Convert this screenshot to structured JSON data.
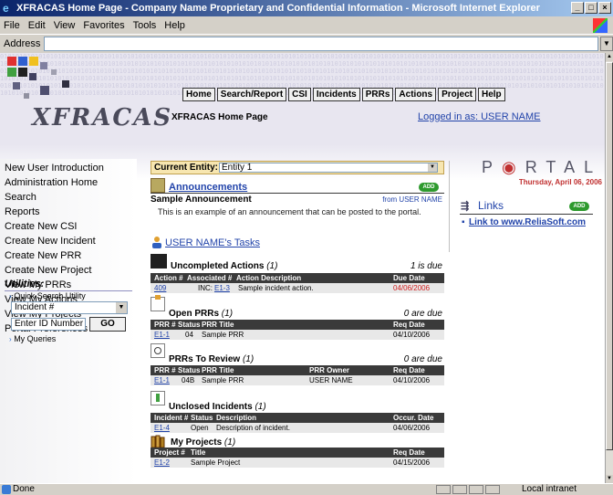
{
  "window": {
    "title": "XFRACAS Home Page - Company Name Proprietary and Confidential Information - Microsoft Internet Explorer"
  },
  "menu": [
    "File",
    "Edit",
    "View",
    "Favorites",
    "Tools",
    "Help"
  ],
  "address": {
    "label": "Address",
    "value": ""
  },
  "header": {
    "logo": "XFRACAS",
    "page_title": "XFRACAS Home Page",
    "logged_in": "Logged in as: USER NAME",
    "binary_bg": "010101010101010101010101010101010101010101010101010101010101010101010101010101010101010101010101010101010101010101010101010101010101010101010101010101010101010101010101010101010101010101010101010101010101010101010101010101010101010101010101010101010101010101010101010101010101010101010101010101010101010101010101010101010101010101010101010101010101010101010101010101010101010101010101010101010101010101010101010101010101010101010101010101010101010101010101010101010101010101010101010101010101010101010101010101010101010101010101010101010101010101010101010101010101010101010101010101010101010101010101010101010101010101010101010101010101010101010101010101010101010101010101010101010101010101010101010101010101010101010101010101010101010101010101010101010101010101010101010101010101010101010101010101010101010101010101010101010101010101010101010101010101010101010101010101010101010101010101010101010101010101"
  },
  "nav": [
    "Home",
    "Search/Report",
    "CSI",
    "Incidents",
    "PRRs",
    "Actions",
    "Project",
    "Help"
  ],
  "sidebar": {
    "links": [
      "New User Introduction",
      "Administration Home",
      "Search",
      "Reports",
      "Create New CSI",
      "Create New Incident",
      "Create New PRR",
      "Create New Project",
      "View My PRRs",
      "View My Actions",
      "View My Projects",
      "Portal Preferences"
    ],
    "utilities_title": "Utilities:",
    "quick_search": "Quick Search Utility",
    "select_value": "Incident #",
    "id_input": "Enter ID Number",
    "go": "GO",
    "my_queries": "My Queries"
  },
  "entity": {
    "label": "Current Entity:",
    "value": "Entity 1"
  },
  "announcements": {
    "title": "Announcements",
    "add": "ADD",
    "item_title": "Sample Announcement",
    "item_from": "from USER NAME",
    "item_body": "This is an example of an announcement that can be posted to the portal."
  },
  "tasks": {
    "title": "USER NAME's Tasks",
    "uncompleted": {
      "title": "Uncompleted Actions",
      "count": "(1)",
      "due": "1 is due",
      "headers": [
        "Action #",
        "Associated #",
        "Action Description",
        "Due Date"
      ],
      "rows": [
        [
          "409",
          "INC:",
          "E1-3",
          "Sample incident action.",
          "04/06/2006"
        ]
      ]
    },
    "open_prrs": {
      "title": "Open PRRs",
      "count": "(1)",
      "due": "0 are due",
      "headers": [
        "PRR #",
        "Status",
        "PRR Title",
        "Req Date"
      ],
      "rows": [
        [
          "E1-1",
          "04",
          "Sample PRR",
          "04/10/2006"
        ]
      ]
    },
    "review_prrs": {
      "title": "PRRs To Review",
      "count": "(1)",
      "due": "0 are due",
      "headers": [
        "PRR #",
        "Status",
        "PRR Title",
        "PRR Owner",
        "Req Date"
      ],
      "rows": [
        [
          "E1-1",
          "04B",
          "Sample PRR",
          "USER NAME",
          "04/10/2006"
        ]
      ]
    },
    "incidents": {
      "title": "Unclosed Incidents",
      "count": "(1)",
      "headers": [
        "Incident #",
        "Status",
        "Description",
        "Occur. Date"
      ],
      "rows": [
        [
          "E1-4",
          "Open",
          "Description of incident.",
          "04/06/2006"
        ]
      ]
    },
    "projects": {
      "title": "My Projects",
      "count": "(1)",
      "headers": [
        "Project #",
        "Title",
        "Req Date"
      ],
      "rows": [
        [
          "E1-2",
          "Sample Project",
          "04/15/2006"
        ]
      ]
    }
  },
  "portal": {
    "title_a": "P",
    "title_b": "RTAL",
    "date": "Thursday, April 06, 2006",
    "links_title": "Links",
    "add": "ADD",
    "link_item": "Link to www.ReliaSoft.com"
  },
  "status": {
    "left": "Done",
    "zone": "Local intranet"
  },
  "colors": {
    "link": "#2244aa",
    "due": "#d02020",
    "add": "#2e9a2e",
    "entity_bar": "#f7e6b0"
  }
}
